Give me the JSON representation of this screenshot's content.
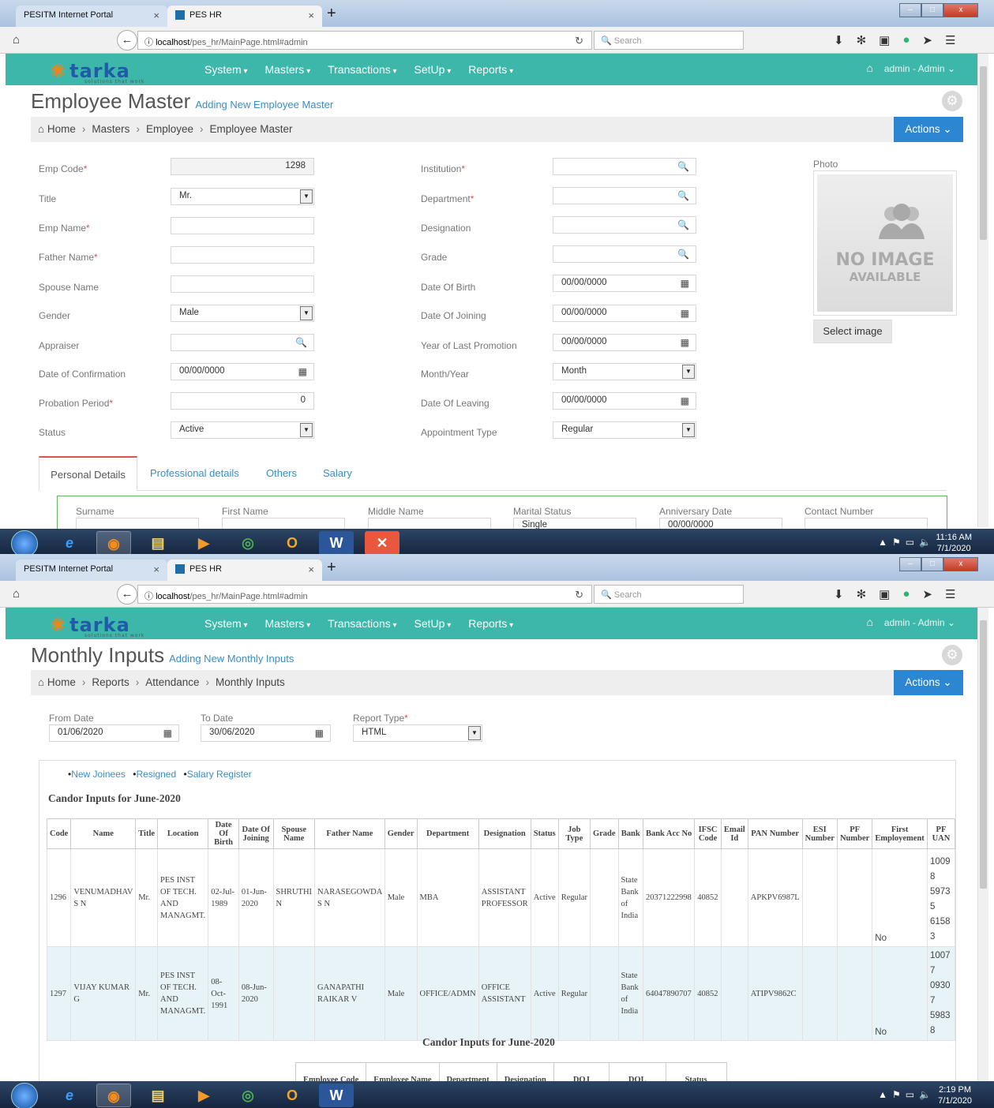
{
  "browser": {
    "tab_inactive": "PESITM Internet Portal",
    "tab_active": "PES HR",
    "url_host": "localhost",
    "url_path": "/pes_hr/MainPage.html#admin",
    "search_placeholder": "Search"
  },
  "app": {
    "logo_text": "tarka",
    "logo_tagline": "solutions that work",
    "menu": [
      "System",
      "Masters",
      "Transactions",
      "SetUp",
      "Reports"
    ],
    "user": "admin - Admin",
    "actions_label": "Actions",
    "accent_color": "#3cb7aa"
  },
  "employee_master": {
    "title": "Employee Master",
    "subtitle": "Adding New Employee Master",
    "breadcrumb": [
      "Home",
      "Masters",
      "Employee",
      "Employee Master"
    ],
    "left_fields": {
      "emp_code": {
        "label": "Emp Code",
        "value": "1298"
      },
      "title": {
        "label": "Title",
        "value": "Mr."
      },
      "emp_name": {
        "label": "Emp Name"
      },
      "father_name": {
        "label": "Father Name"
      },
      "spouse_name": {
        "label": "Spouse Name"
      },
      "gender": {
        "label": "Gender",
        "value": "Male"
      },
      "appraiser": {
        "label": "Appraiser"
      },
      "date_of_confirmation": {
        "label": "Date of Confirmation",
        "value": "00/00/0000"
      },
      "probation_period": {
        "label": "Probation Period",
        "value": "0"
      },
      "status": {
        "label": "Status",
        "value": "Active"
      }
    },
    "right_fields": {
      "institution": {
        "label": "Institution"
      },
      "department": {
        "label": "Department"
      },
      "designation": {
        "label": "Designation"
      },
      "grade": {
        "label": "Grade"
      },
      "date_of_birth": {
        "label": "Date Of Birth",
        "value": "00/00/0000"
      },
      "date_of_joining": {
        "label": "Date Of Joining",
        "value": "00/00/0000"
      },
      "year_last_promotion": {
        "label": "Year of Last Promotion",
        "value": "00/00/0000"
      },
      "month_year": {
        "label": "Month/Year",
        "value": "Month"
      },
      "date_of_leaving": {
        "label": "Date Of Leaving",
        "value": "00/00/0000"
      },
      "appointment_type": {
        "label": "Appointment Type",
        "value": "Regular"
      }
    },
    "photo": {
      "label": "Photo",
      "no_image_1": "NO IMAGE",
      "no_image_2": "AVAILABLE",
      "select_button": "Select image"
    },
    "tabs": [
      "Personal Details",
      "Professional details",
      "Others",
      "Salary"
    ],
    "personal_columns": [
      "Surname",
      "First Name",
      "Middle Name",
      "Marital Status",
      "Anniversary Date",
      "Contact Number"
    ],
    "marital_status_value": "Single",
    "anniversary_value": "00/00/0000"
  },
  "taskbar1": {
    "time": "11:16 AM",
    "date": "7/1/2020"
  },
  "monthly_inputs": {
    "title": "Monthly Inputs",
    "subtitle": "Adding New Monthly Inputs",
    "breadcrumb": [
      "Home",
      "Reports",
      "Attendance",
      "Monthly Inputs"
    ],
    "from_label": "From Date",
    "from_value": "01/06/2020",
    "to_label": "To Date",
    "to_value": "30/06/2020",
    "type_label": "Report Type",
    "type_value": "HTML",
    "links": [
      "New Joinees",
      "Resigned",
      "Salary Register"
    ],
    "heading": "Candor Inputs for June-2020",
    "columns": [
      "Code",
      "Name",
      "Title",
      "Location",
      "Date Of Birth",
      "Date Of Joining",
      "Spouse Name",
      "Father Name",
      "Gender",
      "Department",
      "Designation",
      "Status",
      "Job Type",
      "Grade",
      "Bank",
      "Bank Acc No",
      "IFSC Code",
      "Email Id",
      "PAN Number",
      "ESI Number",
      "PF Number",
      "First Employement",
      "PF UAN"
    ],
    "rows": [
      [
        "1296",
        "VENUMADHAV S N",
        "Mr.",
        "PES INST OF TECH. AND MANAGMT.",
        "02-Jul-1989",
        "01-Jun-2020",
        "SHRUTHI N",
        "NARASEGOWDA S N",
        "Male",
        "MBA",
        "ASSISTANT PROFESSOR",
        "Active",
        "Regular",
        "",
        "State Bank of India",
        "20371222998",
        "40852",
        "",
        "APKPV6987L",
        "",
        "",
        "No",
        "1009 8 5973 5 6158 3"
      ],
      [
        "1297",
        "VIJAY KUMAR G",
        "Mr.",
        "PES INST OF TECH. AND MANAGMT.",
        "08-Oct-1991",
        "08-Jun-2020",
        "",
        "GANAPATHI RAIKAR V",
        "Male",
        "OFFICE/ADMN",
        "OFFICE ASSISTANT",
        "Active",
        "Regular",
        "",
        "State Bank of India",
        "64047890707",
        "40852",
        "",
        "ATIPV9862C",
        "",
        "",
        "No",
        "1007 7 0930 7 5983 8"
      ]
    ],
    "heading2": "Candor Inputs for June-2020",
    "summary_columns": [
      "Employee Code",
      "Employee Name",
      "Department",
      "Designation",
      "DOJ",
      "DOL",
      "Status"
    ]
  },
  "taskbar2": {
    "time": "2:19 PM",
    "date": "7/1/2020"
  }
}
